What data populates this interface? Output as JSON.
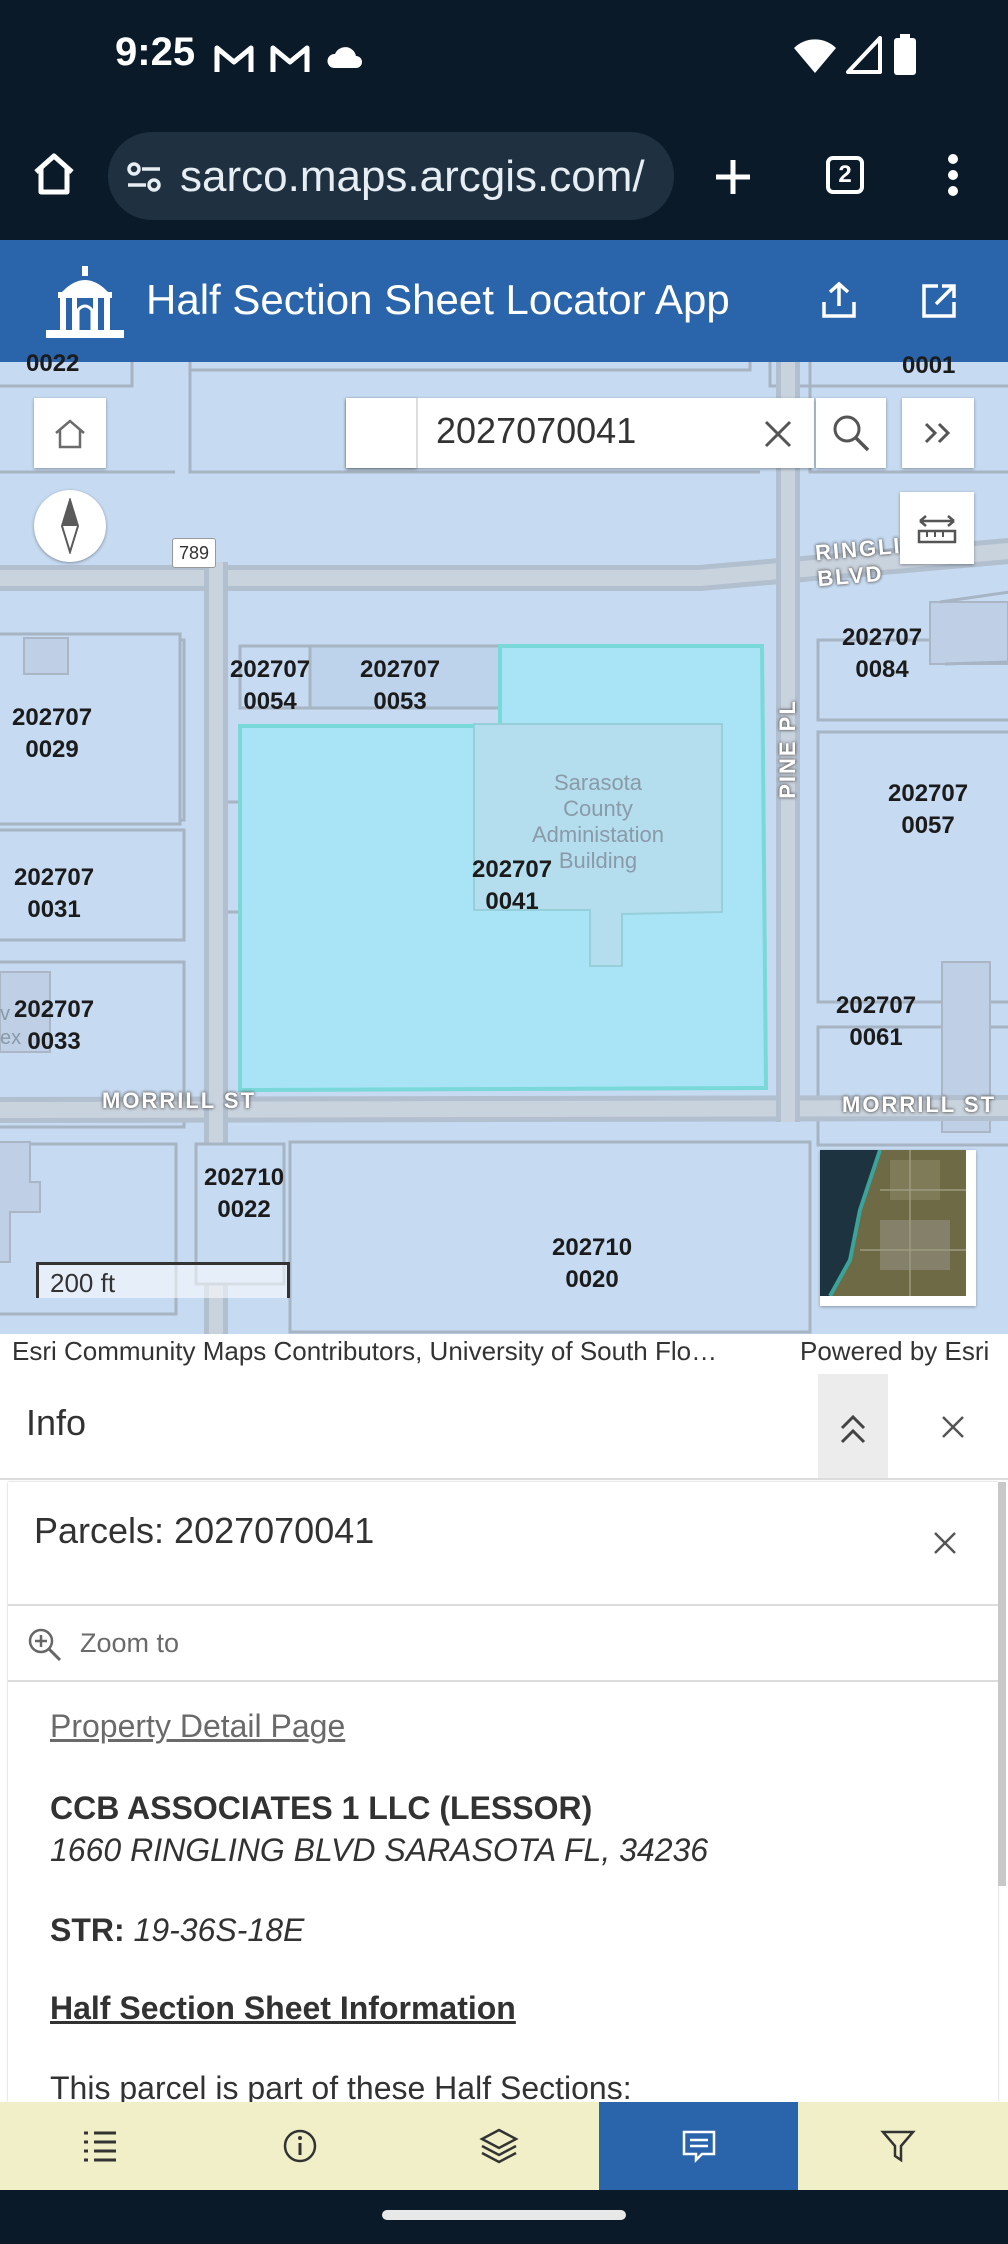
{
  "status_bar": {
    "time": "9:25",
    "icons": [
      "gmail-icon",
      "gmail-icon",
      "cloud-icon",
      "wifi-icon",
      "signal-icon",
      "battery-icon"
    ]
  },
  "browser": {
    "url": "sarco.maps.arcgis.com/",
    "tab_count": "2",
    "icons": [
      "home-icon",
      "site-settings-icon",
      "new-tab-icon",
      "tabs-icon",
      "more-icon"
    ]
  },
  "app": {
    "title": "Half Section Sheet Locator App",
    "icons": [
      "county-logo",
      "share-icon",
      "launch-icon"
    ]
  },
  "map": {
    "search_value": "2027070041",
    "scale_label": "200 ft",
    "road_marker": "789",
    "roads": [
      "RINGLING BLVD",
      "PINE PL",
      "MORRILL ST",
      "MORRILL ST"
    ],
    "top_labels": [
      "0022",
      "0001"
    ],
    "building_label": [
      "Sarasota",
      "County",
      "Administation",
      "Building"
    ],
    "building_partial_label": [
      "v",
      "ex"
    ],
    "parcels": [
      {
        "l1": "202707",
        "l2": "0054"
      },
      {
        "l1": "202707",
        "l2": "0053"
      },
      {
        "l1": "202707",
        "l2": "0029"
      },
      {
        "l1": "202707",
        "l2": "0041"
      },
      {
        "l1": "202707",
        "l2": "0031"
      },
      {
        "l1": "202707",
        "l2": "0033"
      },
      {
        "l1": "202707",
        "l2": "0084"
      },
      {
        "l1": "202707",
        "l2": "0057"
      },
      {
        "l1": "202707",
        "l2": "0061"
      },
      {
        "l1": "202710",
        "l2": "0022"
      },
      {
        "l1": "202710",
        "l2": "0020"
      }
    ],
    "attribution": "Esri Community Maps Contributors, University of South Flo…",
    "powered_by": "Powered by Esri"
  },
  "info": {
    "header": "Info",
    "parcel_title": "Parcels: 2027070041",
    "zoom_to": "Zoom to",
    "detail_link": "Property Detail Page",
    "owner": "CCB ASSOCIATES 1 LLC (LESSOR)",
    "address": "1660 RINGLING BLVD SARASOTA FL, 34236",
    "str_label": "STR:",
    "str_value": "19-36S-18E",
    "hss_heading": "Half Section Sheet Information",
    "hs_text": "This parcel is part of these Half Sections:"
  },
  "toolbar": {
    "items": [
      "list-icon",
      "info-icon",
      "layers-icon",
      "popup-icon",
      "filter-icon"
    ],
    "active_index": 3
  },
  "colors": {
    "header": "#2a64ab",
    "selected_parcel": "#a8e4f5",
    "toolbar_bg": "#f1efc8"
  }
}
